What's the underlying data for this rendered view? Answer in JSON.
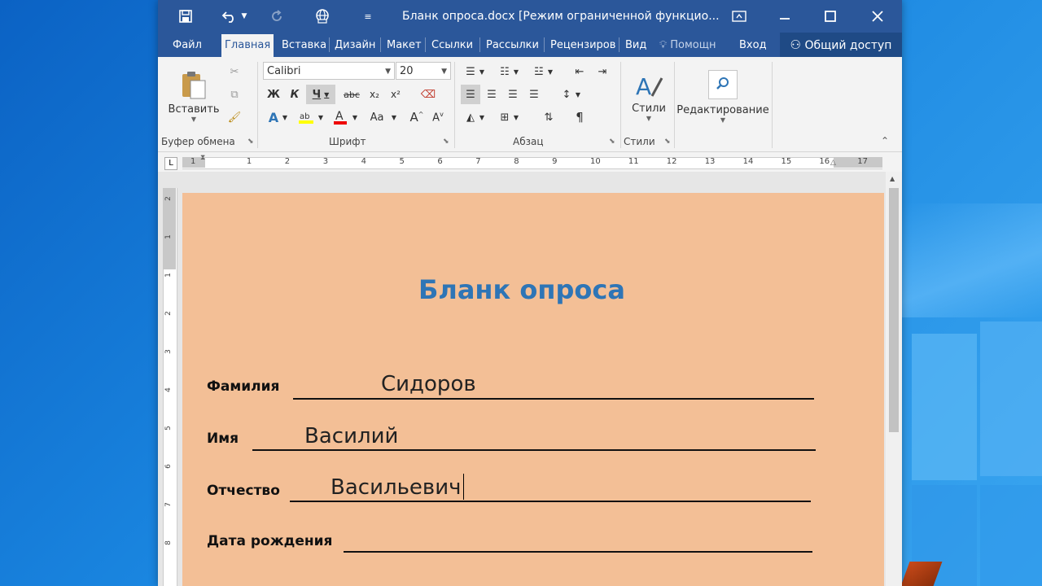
{
  "window": {
    "title": "Бланк опроса.docx [Режим ограниченной функцио..."
  },
  "tabs": [
    {
      "label": "Файл"
    },
    {
      "label": "Главная"
    },
    {
      "label": "Вставка"
    },
    {
      "label": "Дизайн"
    },
    {
      "label": "Макет"
    },
    {
      "label": "Ссылки"
    },
    {
      "label": "Рассылки"
    },
    {
      "label": "Рецензиров"
    },
    {
      "label": "Вид"
    },
    {
      "label": "Помощн"
    },
    {
      "label": "Вход"
    }
  ],
  "share_label": "Общий доступ",
  "ribbon": {
    "clipboard": {
      "paste_label": "Вставить",
      "group_label": "Буфер обмена"
    },
    "font": {
      "font_name": "Calibri",
      "font_size": "20",
      "group_label": "Шрифт",
      "bold": "Ж",
      "italic": "К",
      "underline": "Ч",
      "strike": "abc",
      "sub": "x₂",
      "sup": "x²",
      "case": "Aa"
    },
    "paragraph": {
      "group_label": "Абзац",
      "pilcrow": "¶"
    },
    "styles": {
      "label": "Стили",
      "group_label": "Стили"
    },
    "editing": {
      "label": "Редактирование"
    }
  },
  "ruler": {
    "numbers": [
      "1",
      "1",
      "2",
      "3",
      "4",
      "5",
      "6",
      "7",
      "8",
      "9",
      "10",
      "11",
      "12",
      "13",
      "14",
      "15",
      "16",
      "17"
    ],
    "v_numbers": [
      "2",
      "1",
      "1",
      "2",
      "3",
      "4",
      "5",
      "6",
      "7",
      "8"
    ]
  },
  "document": {
    "title": "Бланк опроса",
    "fields": [
      {
        "label": "Фамилия",
        "value": "Сидоров"
      },
      {
        "label": "Имя",
        "value": "Василий"
      },
      {
        "label": "Отчество",
        "value": "Васильевич"
      },
      {
        "label": "Дата рождения",
        "value": ""
      }
    ]
  },
  "colors": {
    "title_bar": "#2b579a",
    "page_background": "#f3bf96",
    "doc_title": "#2e75b6"
  }
}
